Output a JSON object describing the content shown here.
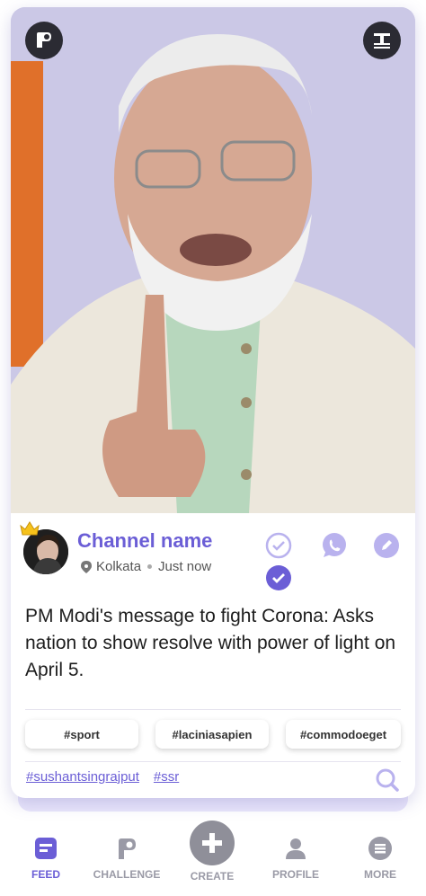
{
  "post": {
    "channel_name": "Channel name",
    "location": "Kolkata",
    "time": "Just now",
    "headline": "PM Modi's message to fight Corona: Asks nation to show resolve with power of light on April 5.",
    "tags": [
      "#sport",
      "#laciniasapien",
      "#commodoeget"
    ],
    "hashtags": [
      "#sushantsingrajput",
      "#ssr"
    ]
  },
  "nav": {
    "items": [
      {
        "label": "FEED",
        "icon": "feed-icon"
      },
      {
        "label": "CHALLENGE",
        "icon": "challenge-icon"
      },
      {
        "label": "CREATE",
        "icon": "plus-icon"
      },
      {
        "label": "PROFILE",
        "icon": "profile-icon"
      },
      {
        "label": "MORE",
        "icon": "menu-icon"
      }
    ],
    "active": "FEED"
  },
  "colors": {
    "accent": "#6b5ed6",
    "accent_light": "#b9b2ee",
    "dark_button": "#2b2b33"
  }
}
